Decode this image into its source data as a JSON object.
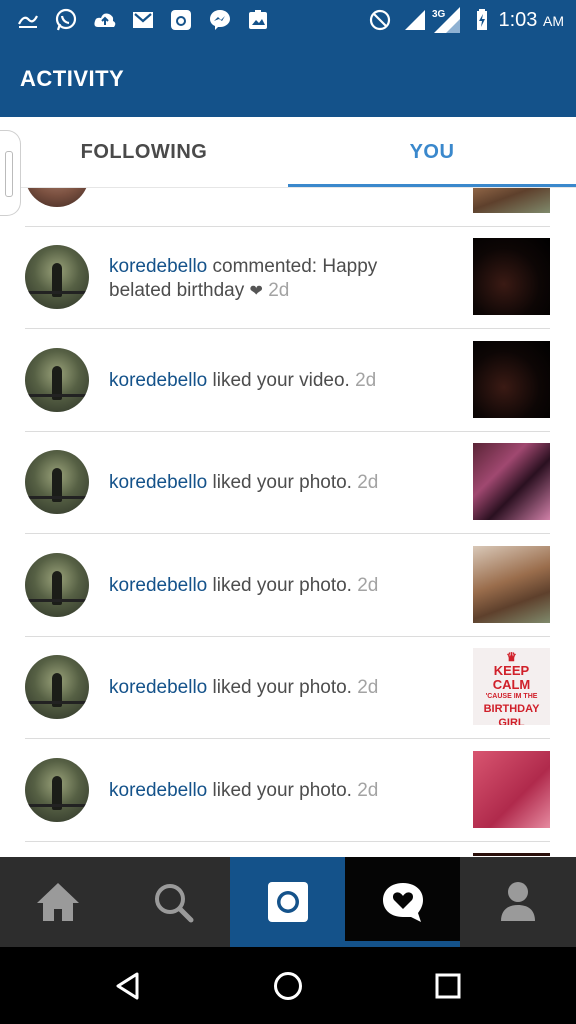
{
  "status_bar": {
    "time": "1:03",
    "ampm": "AM",
    "network": "3G",
    "icons": [
      "app-notification-icon",
      "whatsapp-icon",
      "upload-icon",
      "gmail-icon",
      "instagram-icon",
      "messenger-icon",
      "photos-icon",
      "do-not-disturb-icon",
      "signal-icon",
      "network-3g-icon",
      "battery-charging-icon"
    ]
  },
  "app_bar": {
    "title": "ACTIVITY"
  },
  "tabs": [
    {
      "label": "FOLLOWING",
      "active": false
    },
    {
      "label": "YOU",
      "active": true
    }
  ],
  "activity": [
    {
      "username": "koredebello",
      "action": "commented: Happy belated birthday",
      "emoji": "❤",
      "time": "2d",
      "thumb": "dark-video-frame"
    },
    {
      "username": "koredebello",
      "action": "liked your video.",
      "time": "2d",
      "thumb": "dark-video-frame"
    },
    {
      "username": "koredebello",
      "action": "liked your photo.",
      "time": "2d",
      "thumb": "party-collage"
    },
    {
      "username": "koredebello",
      "action": "liked your photo.",
      "time": "2d",
      "thumb": "selfie"
    },
    {
      "username": "koredebello",
      "action": "liked your photo.",
      "time": "2d",
      "thumb": "keep-calm-poster",
      "thumb_text": {
        "line1": "KEEP",
        "line2": "CALM",
        "line3": "'CAUSE IM THE",
        "line4": "BIRTHDAY",
        "line5": "GIRL"
      }
    },
    {
      "username": "koredebello",
      "action": "liked your photo.",
      "time": "2d",
      "thumb": "birthday-cake"
    }
  ],
  "bottom_nav": [
    {
      "name": "home",
      "icon": "home-icon"
    },
    {
      "name": "search",
      "icon": "search-icon"
    },
    {
      "name": "camera",
      "icon": "camera-icon",
      "highlight": "#14528a"
    },
    {
      "name": "activity",
      "icon": "heart-bubble-icon",
      "active": true
    },
    {
      "name": "profile",
      "icon": "person-icon"
    }
  ],
  "system_nav": [
    "back-icon",
    "home-circle-icon",
    "recents-icon"
  ],
  "colors": {
    "brand": "#14528a",
    "tab_active": "#3a88cc",
    "username": "#14528a",
    "text": "#4d4d4d",
    "time": "#a3a3a3"
  }
}
